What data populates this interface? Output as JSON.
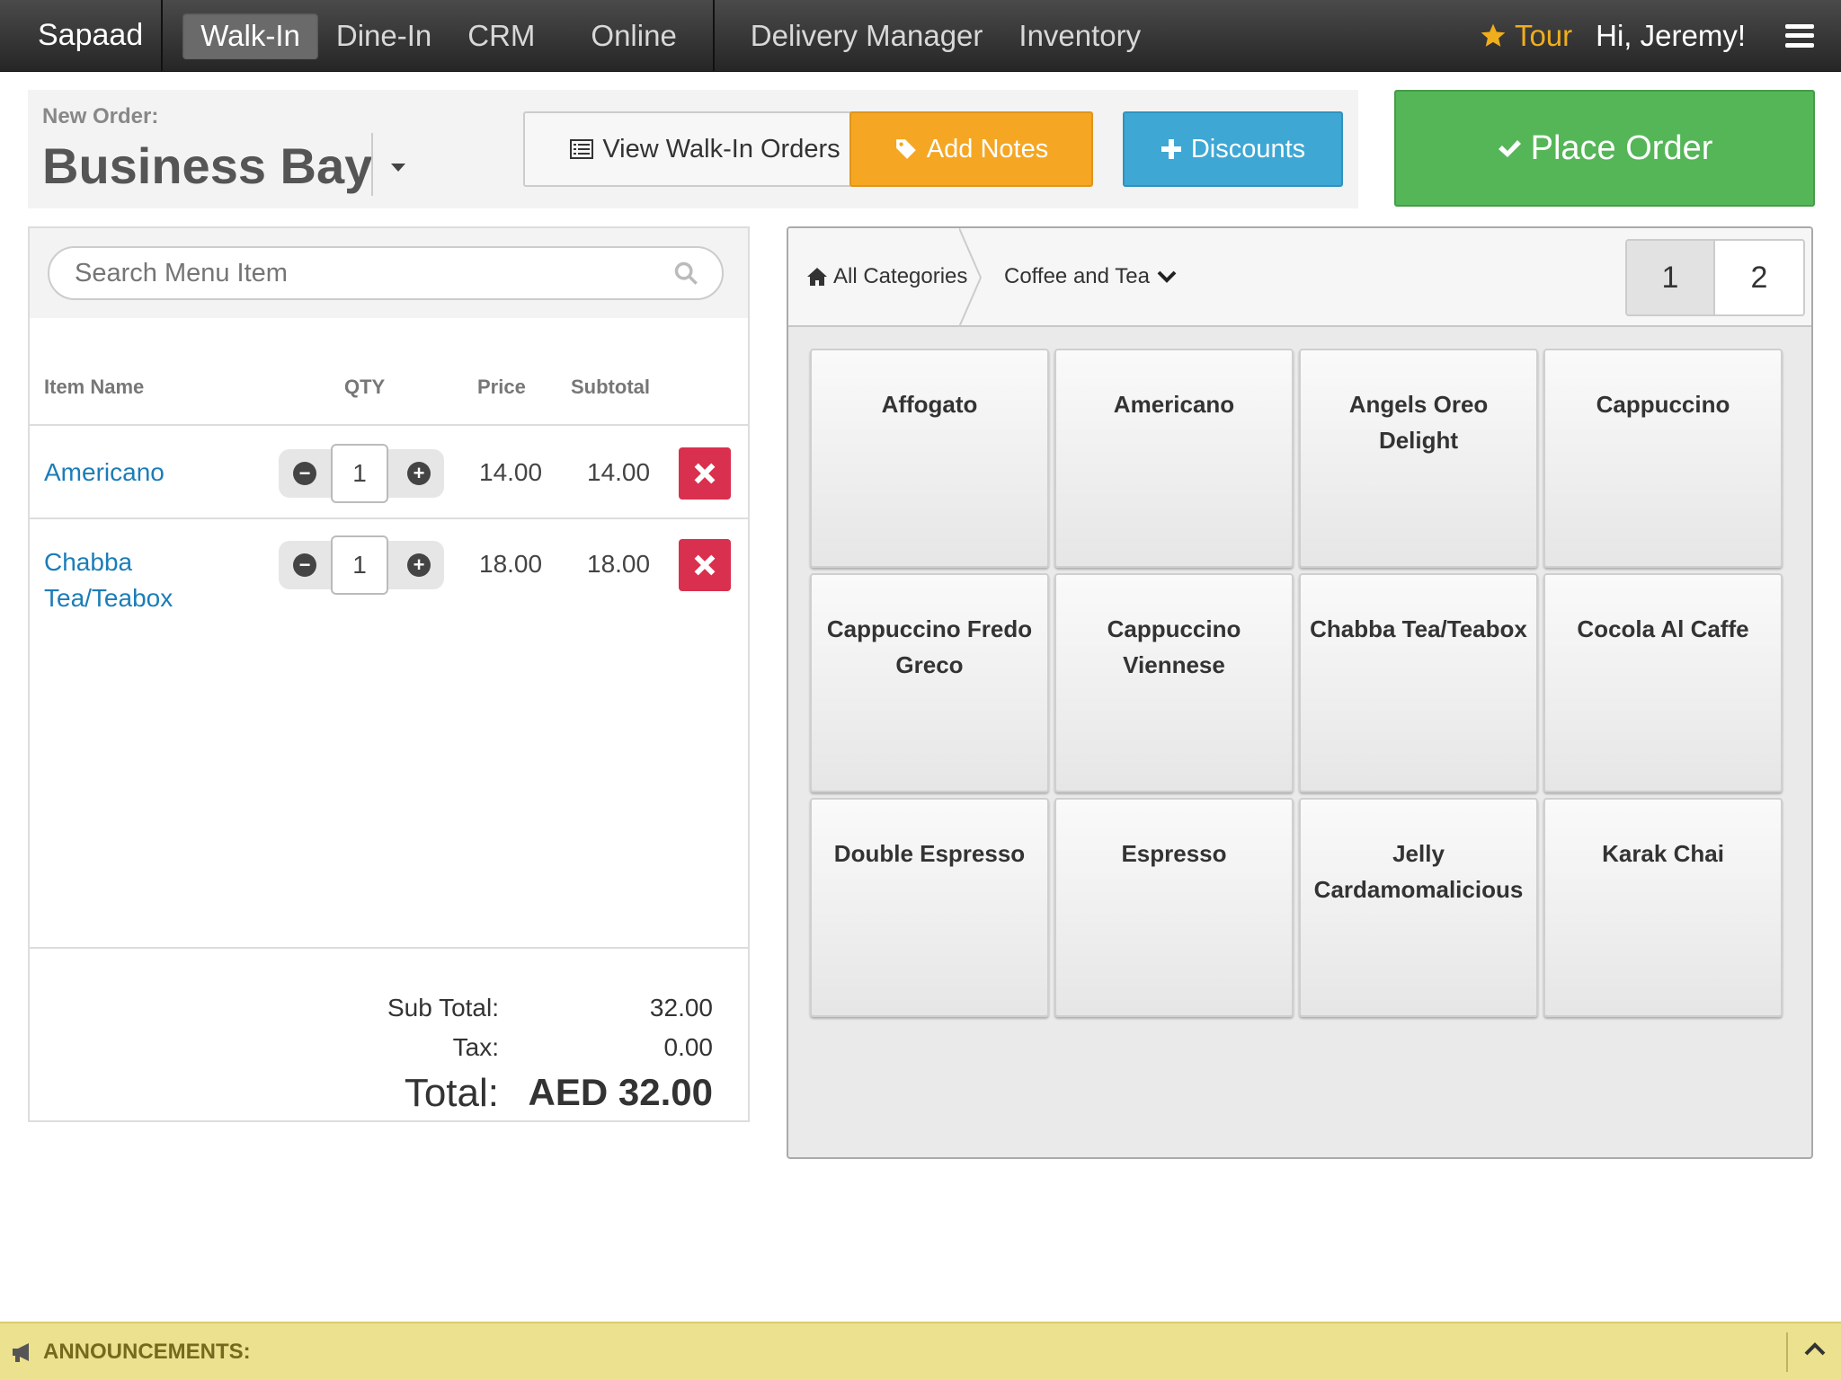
{
  "nav": {
    "brand": "Sapaad",
    "items": [
      "Walk-In",
      "Dine-In",
      "CRM",
      "Online",
      "Delivery Manager",
      "Inventory"
    ],
    "active": "Walk-In",
    "tour": "Tour",
    "greeting": "Hi, Jeremy!"
  },
  "order": {
    "label": "New Order:",
    "location": "Business Bay",
    "view_orders": "View Walk-In Orders",
    "add_notes": "Add Notes",
    "discounts": "Discounts",
    "place_order": "Place Order"
  },
  "cart": {
    "search_placeholder": "Search Menu Item",
    "headers": {
      "item": "Item Name",
      "qty": "QTY",
      "price": "Price",
      "subtotal": "Subtotal"
    },
    "rows": [
      {
        "name": "Americano",
        "qty": "1",
        "price": "14.00",
        "subtotal": "14.00"
      },
      {
        "name": "Chabba Tea/Teabox",
        "qty": "1",
        "price": "18.00",
        "subtotal": "18.00"
      }
    ],
    "sub_total_label": "Sub Total:",
    "sub_total": "32.00",
    "tax_label": "Tax:",
    "tax": "0.00",
    "total_label": "Total:",
    "total": "AED 32.00"
  },
  "menu": {
    "breadcrumb_home": "All Categories",
    "category": "Coffee and Tea",
    "pages": [
      "1",
      "2"
    ],
    "active_page": "1",
    "items": [
      "Affogato",
      "Americano",
      "Angels Oreo Delight",
      "Cappuccino",
      "Cappuccino Fredo Greco",
      "Cappuccino Viennese",
      "Chabba Tea/Teabox",
      "Cocola Al Caffe",
      "Double Espresso",
      "Espresso",
      "Jelly Cardamomalicious",
      "Karak Chai"
    ]
  },
  "announcements": {
    "label": "ANNOUNCEMENTS:"
  },
  "colors": {
    "place_order": "#55b658",
    "add_notes": "#f5a623",
    "discounts": "#3ea7d4",
    "delete": "#d9304f",
    "link": "#1b7db8",
    "tour": "#f0ad1c",
    "announce_bg": "#ebe18e"
  }
}
